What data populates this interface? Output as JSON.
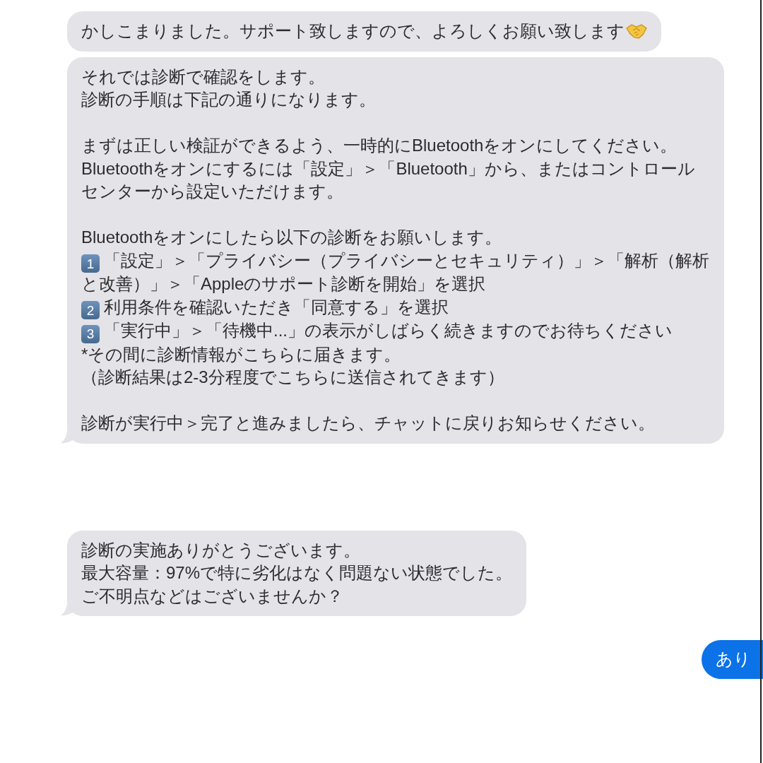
{
  "messages": [
    {
      "kind": "received",
      "tail": false,
      "paragraphs": [
        [
          {
            "kind": "text_handshake",
            "text": "かしこまりました。サポート致しますので、よろしくお願い致します"
          }
        ]
      ]
    },
    {
      "kind": "received",
      "tail": true,
      "paragraphs": [
        [
          {
            "kind": "text",
            "text": "それでは診断で確認をします。"
          },
          {
            "kind": "text",
            "text": "診断の手順は下記の通りになります。"
          }
        ],
        [
          {
            "kind": "text",
            "text": "まずは正しい検証ができるよう、一時的にBluetoothをオンにしてください。"
          },
          {
            "kind": "text",
            "text": "Bluetoothをオンにするには「設定」＞「Bluetooth」から、またはコントロールセンターから設定いただけます。"
          }
        ],
        [
          {
            "kind": "text",
            "text": "Bluetoothをオンにしたら以下の診断をお願いします。"
          },
          {
            "kind": "step",
            "number": "1",
            "text": "「設定」＞「プライバシー（プライバシーとセキュリティ）」＞「解析（解析と改善）」＞「Appleのサポート診断を開始」を選択"
          },
          {
            "kind": "step",
            "number": "2",
            "text": "利用条件を確認いただき「同意する」を選択"
          },
          {
            "kind": "step",
            "number": "3",
            "text": "「実行中」＞「待機中...」の表示がしばらく続きますのでお待ちください"
          },
          {
            "kind": "text",
            "text": "*その間に診断情報がこちらに届きます。"
          },
          {
            "kind": "text",
            "text": "（診断結果は2-3分程度でこちらに送信されてきます）"
          }
        ],
        [
          {
            "kind": "text",
            "text": "診断が実行中＞完了と進みましたら、チャットに戻りお知らせください。"
          }
        ]
      ]
    },
    {
      "kind": "received",
      "tail": true,
      "paragraphs": [
        [
          {
            "kind": "text",
            "text": "診断の実施ありがとうございます。"
          },
          {
            "kind": "text",
            "text": "最大容量：97%で特に劣化はなく問題ない状態でした。"
          },
          {
            "kind": "text",
            "text": "ご不明点などはございませんか？"
          }
        ]
      ]
    },
    {
      "kind": "sent",
      "paragraphs": [
        [
          {
            "kind": "text",
            "text": "あり"
          }
        ]
      ]
    }
  ]
}
